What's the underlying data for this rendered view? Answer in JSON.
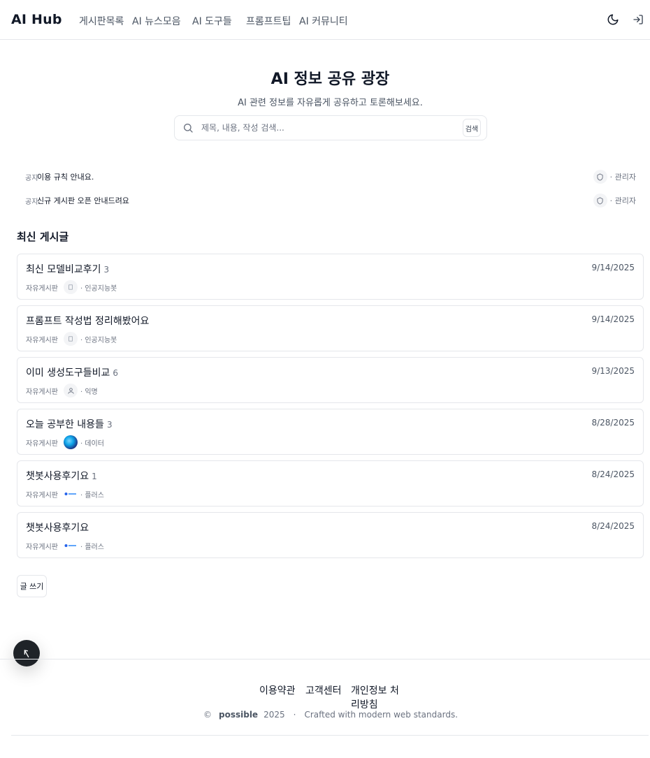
{
  "header": {
    "brand": "AI Hub",
    "nav": [
      "게시판목록",
      "AI 뉴스모음",
      "AI 도구들",
      "프롬프트팁",
      "AI 커뮤니티"
    ],
    "theme_icon": "moon-icon",
    "login_icon": "login-icon"
  },
  "hero": {
    "title": "AI 정보 공유 광장",
    "subtitle": "AI 관련 정보를 자유롭게 공유하고 토론해보세요.",
    "search_placeholder": "제목, 내용, 작성 검색...",
    "search_button": "검색"
  },
  "notices": [
    {
      "tag": "공지",
      "text": "이용 규칙 안내요.",
      "author": "· 관리자"
    },
    {
      "tag": "공지",
      "text": "신규 게시판 오픈 안내드려요",
      "author": "· 관리자"
    }
  ],
  "section_title": "최신 게시글",
  "posts": [
    {
      "title": "최신 모델비교후기",
      "count": "3",
      "date": "9/14/2025",
      "category": "자유게시판",
      "author": "· 인공지능봇",
      "avatar": "plain"
    },
    {
      "title": "프롬프트 작성법 정리해봤어요",
      "count": "",
      "date": "9/14/2025",
      "category": "자유게시판",
      "author": "· 인공지능봇",
      "avatar": "plain"
    },
    {
      "title": "이미 생성도구들비교",
      "count": "6",
      "date": "9/13/2025",
      "category": "자유게시판",
      "author": "· 익명",
      "avatar": "user"
    },
    {
      "title": "오늘 공부한 내용들",
      "count": "3",
      "date": "8/28/2025",
      "category": "자유게시판",
      "author": "· 데이터",
      "avatar": "globe"
    },
    {
      "title": "챗봇사용후기요",
      "count": "1",
      "date": "8/24/2025",
      "category": "자유게시판",
      "author": "· 플러스",
      "avatar": "logo"
    },
    {
      "title": "챗봇사용후기요",
      "count": "",
      "date": "8/24/2025",
      "category": "자유게시판",
      "author": "· 플러스",
      "avatar": "logo"
    }
  ],
  "write_button": "글 쓰기",
  "footer": {
    "links": [
      "이용약관",
      "고객센터",
      "개인정보 처리방침"
    ],
    "copyright_symbol": "©",
    "owner": "possible",
    "year": "2025",
    "separator": "·",
    "tagline": "Crafted with modern web standards."
  }
}
